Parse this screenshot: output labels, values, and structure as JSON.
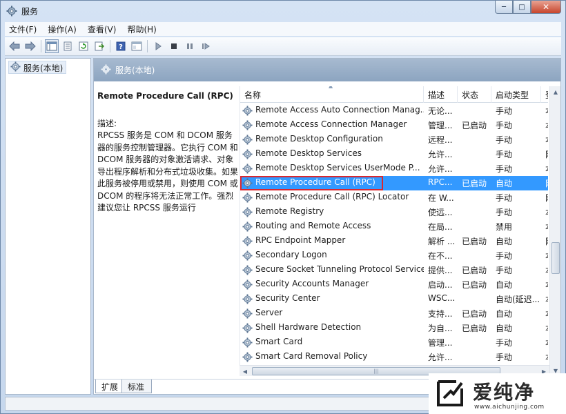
{
  "window": {
    "title": "服务",
    "buttons": {
      "minimize": "─",
      "maximize": "□",
      "close": "✕"
    }
  },
  "menu": [
    {
      "label": "文件(F)"
    },
    {
      "label": "操作(A)"
    },
    {
      "label": "查看(V)"
    },
    {
      "label": "帮助(H)"
    }
  ],
  "toolbar": {
    "icons": [
      "back-arrow-icon",
      "forward-arrow-icon",
      "show-hide-console-tree-icon",
      "properties-icon",
      "refresh-icon",
      "export-list-icon",
      "help-icon",
      "view-icon",
      "start-service-icon",
      "stop-service-icon",
      "pause-service-icon",
      "restart-service-icon"
    ]
  },
  "tree": {
    "item_label": "服务(本地)"
  },
  "content": {
    "header_label": "服务(本地)",
    "description": {
      "service_name": "Remote Procedure Call (RPC)",
      "label": "描述:",
      "text": "RPCSS 服务是 COM 和 DCOM 服务器的服务控制管理器。它执行 COM 和 DCOM 服务器的对象激活请求、对象导出程序解析和分布式垃圾收集。如果此服务被停用或禁用，则使用 COM 或 DCOM 的程序将无法正常工作。强烈建议您让 RPCSS 服务运行"
    },
    "columns": {
      "name": "名称",
      "description": "描述",
      "status": "状态",
      "startup": "启动类型",
      "extra": "登"
    },
    "rows": [
      {
        "name": "Remote Access Auto Connection Manag...",
        "description": "无论...",
        "status": "",
        "startup": "手动",
        "extra": "本"
      },
      {
        "name": "Remote Access Connection Manager",
        "description": "管理...",
        "status": "已启动",
        "startup": "手动",
        "extra": "本"
      },
      {
        "name": "Remote Desktop Configuration",
        "description": "远程...",
        "status": "",
        "startup": "手动",
        "extra": "本"
      },
      {
        "name": "Remote Desktop Services",
        "description": "允许...",
        "status": "",
        "startup": "手动",
        "extra": "网"
      },
      {
        "name": "Remote Desktop Services UserMode P...",
        "description": "允许...",
        "status": "",
        "startup": "手动",
        "extra": "本"
      },
      {
        "name": "Remote Procedure Call (RPC)",
        "description": "RPC...",
        "status": "已启动",
        "startup": "自动",
        "extra": "网",
        "selected": true
      },
      {
        "name": "Remote Procedure Call (RPC) Locator",
        "description": "在 W...",
        "status": "",
        "startup": "手动",
        "extra": "网"
      },
      {
        "name": "Remote Registry",
        "description": "使远...",
        "status": "",
        "startup": "手动",
        "extra": "本"
      },
      {
        "name": "Routing and Remote Access",
        "description": "在局...",
        "status": "",
        "startup": "禁用",
        "extra": "本"
      },
      {
        "name": "RPC Endpoint Mapper",
        "description": "解析 ...",
        "status": "已启动",
        "startup": "自动",
        "extra": "网"
      },
      {
        "name": "Secondary Logon",
        "description": "在不...",
        "status": "",
        "startup": "手动",
        "extra": "本"
      },
      {
        "name": "Secure Socket Tunneling Protocol Service",
        "description": "提供...",
        "status": "已启动",
        "startup": "手动",
        "extra": "本"
      },
      {
        "name": "Security Accounts Manager",
        "description": "启动...",
        "status": "已启动",
        "startup": "自动",
        "extra": "本"
      },
      {
        "name": "Security Center",
        "description": "WSC...",
        "status": "",
        "startup": "自动(延迟...",
        "extra": "本"
      },
      {
        "name": "Server",
        "description": "支持...",
        "status": "已启动",
        "startup": "自动",
        "extra": "本"
      },
      {
        "name": "Shell Hardware Detection",
        "description": "为自...",
        "status": "已启动",
        "startup": "自动",
        "extra": "本"
      },
      {
        "name": "Smart Card",
        "description": "管理...",
        "status": "",
        "startup": "手动",
        "extra": "本"
      },
      {
        "name": "Smart Card Removal Policy",
        "description": "允许...",
        "status": "",
        "startup": "手动",
        "extra": "本"
      }
    ],
    "tabs": [
      {
        "label": "扩展"
      },
      {
        "label": "标准"
      }
    ]
  },
  "watermark": {
    "text": "爱纯净",
    "url": "www.aichunjing.com"
  },
  "colors": {
    "selection": "#3399ff",
    "highlight_border": "#d9272f",
    "header_gradient": "#8ca4c0"
  }
}
